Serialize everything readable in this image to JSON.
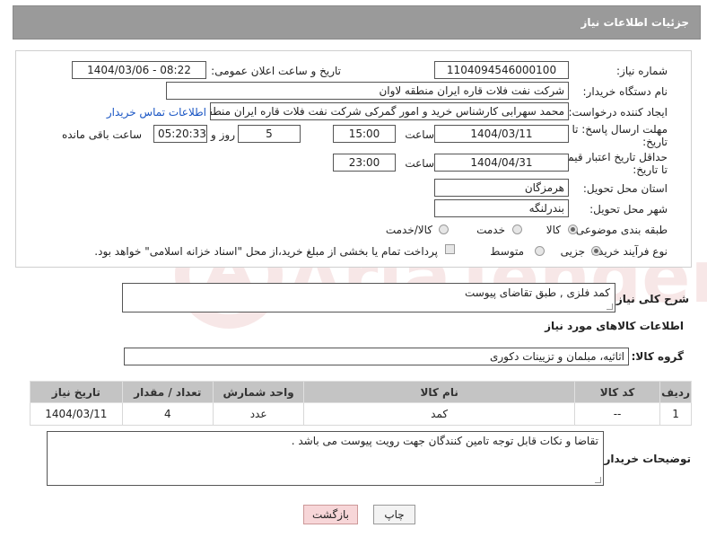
{
  "header": {
    "title": "جزئیات اطلاعات نیاز"
  },
  "fields": {
    "need_number_label": "شماره نیاز:",
    "need_number": "1104094546000100",
    "announce_label": "تاریخ و ساعت اعلان عمومی:",
    "announce_value": "1404/03/06 - 08:22",
    "buyer_label": "نام دستگاه خریدار:",
    "buyer_value": "شرکت نفت فلات قاره ایران منطقه لاوان",
    "creator_label": "ایجاد کننده درخواست:",
    "creator_value": "محمد سهرابی کارشناس خرید و امور گمرکی شرکت نفت فلات قاره ایران منطقه",
    "contact_link": "اطلاعات تماس خریدار",
    "reply_label_1": "مهلت ارسال پاسخ: تا",
    "reply_label_2": "تاریخ:",
    "reply_date": "1404/03/11",
    "time_label": "ساعت",
    "reply_time": "15:00",
    "days_value": "5",
    "days_label": "روز و",
    "remaining_time": "05:20:33",
    "remaining_label": "ساعت باقی مانده",
    "validity_label_1": "حداقل تاریخ اعتبار قیمت:",
    "validity_label_2": "تا تاریخ:",
    "validity_date": "1404/04/31",
    "validity_time": "23:00",
    "province_label": "استان محل تحویل:",
    "province_value": "هرمزگان",
    "city_label": "شهر محل تحویل:",
    "city_value": "بندرلنگه",
    "category_label": "طبقه بندی موضوعی:",
    "category_options": [
      "کالا",
      "خدمت",
      "کالا/خدمت"
    ],
    "category_selected": "کالا",
    "process_label": "نوع فرآیند خرید :",
    "process_options": [
      "جزیی",
      "متوسط"
    ],
    "process_selected": "جزیی",
    "payment_text": "پرداخت تمام یا بخشی از مبلغ خرید،از محل \"اسناد خزانه اسلامی\" خواهد بود."
  },
  "description": {
    "label": "شرح کلی نیاز:",
    "value": "کمد فلزی , طبق تقاضای پیوست"
  },
  "goods": {
    "section_title": "اطلاعات کالاهای مورد نیاز",
    "group_label": "گروه کالا:",
    "group_value": "اثاثیه، مبلمان و تزیینات دکوری",
    "columns": [
      "ردیف",
      "کد کالا",
      "نام کالا",
      "واحد شمارش",
      "تعداد / مقدار",
      "تاریخ نیاز"
    ],
    "rows": [
      [
        "1",
        "--",
        "کمد",
        "عدد",
        "4",
        "1404/03/11"
      ]
    ]
  },
  "buyer_notes": {
    "label": "توضیحات خریدار:",
    "value": "تقاضا و نکات قابل توجه تامین کنندگان جهت رویت پیوست می باشد ."
  },
  "buttons": {
    "print": "چاپ",
    "back": "بازگشت"
  },
  "watermark": {
    "text": "AriaTender.net"
  }
}
